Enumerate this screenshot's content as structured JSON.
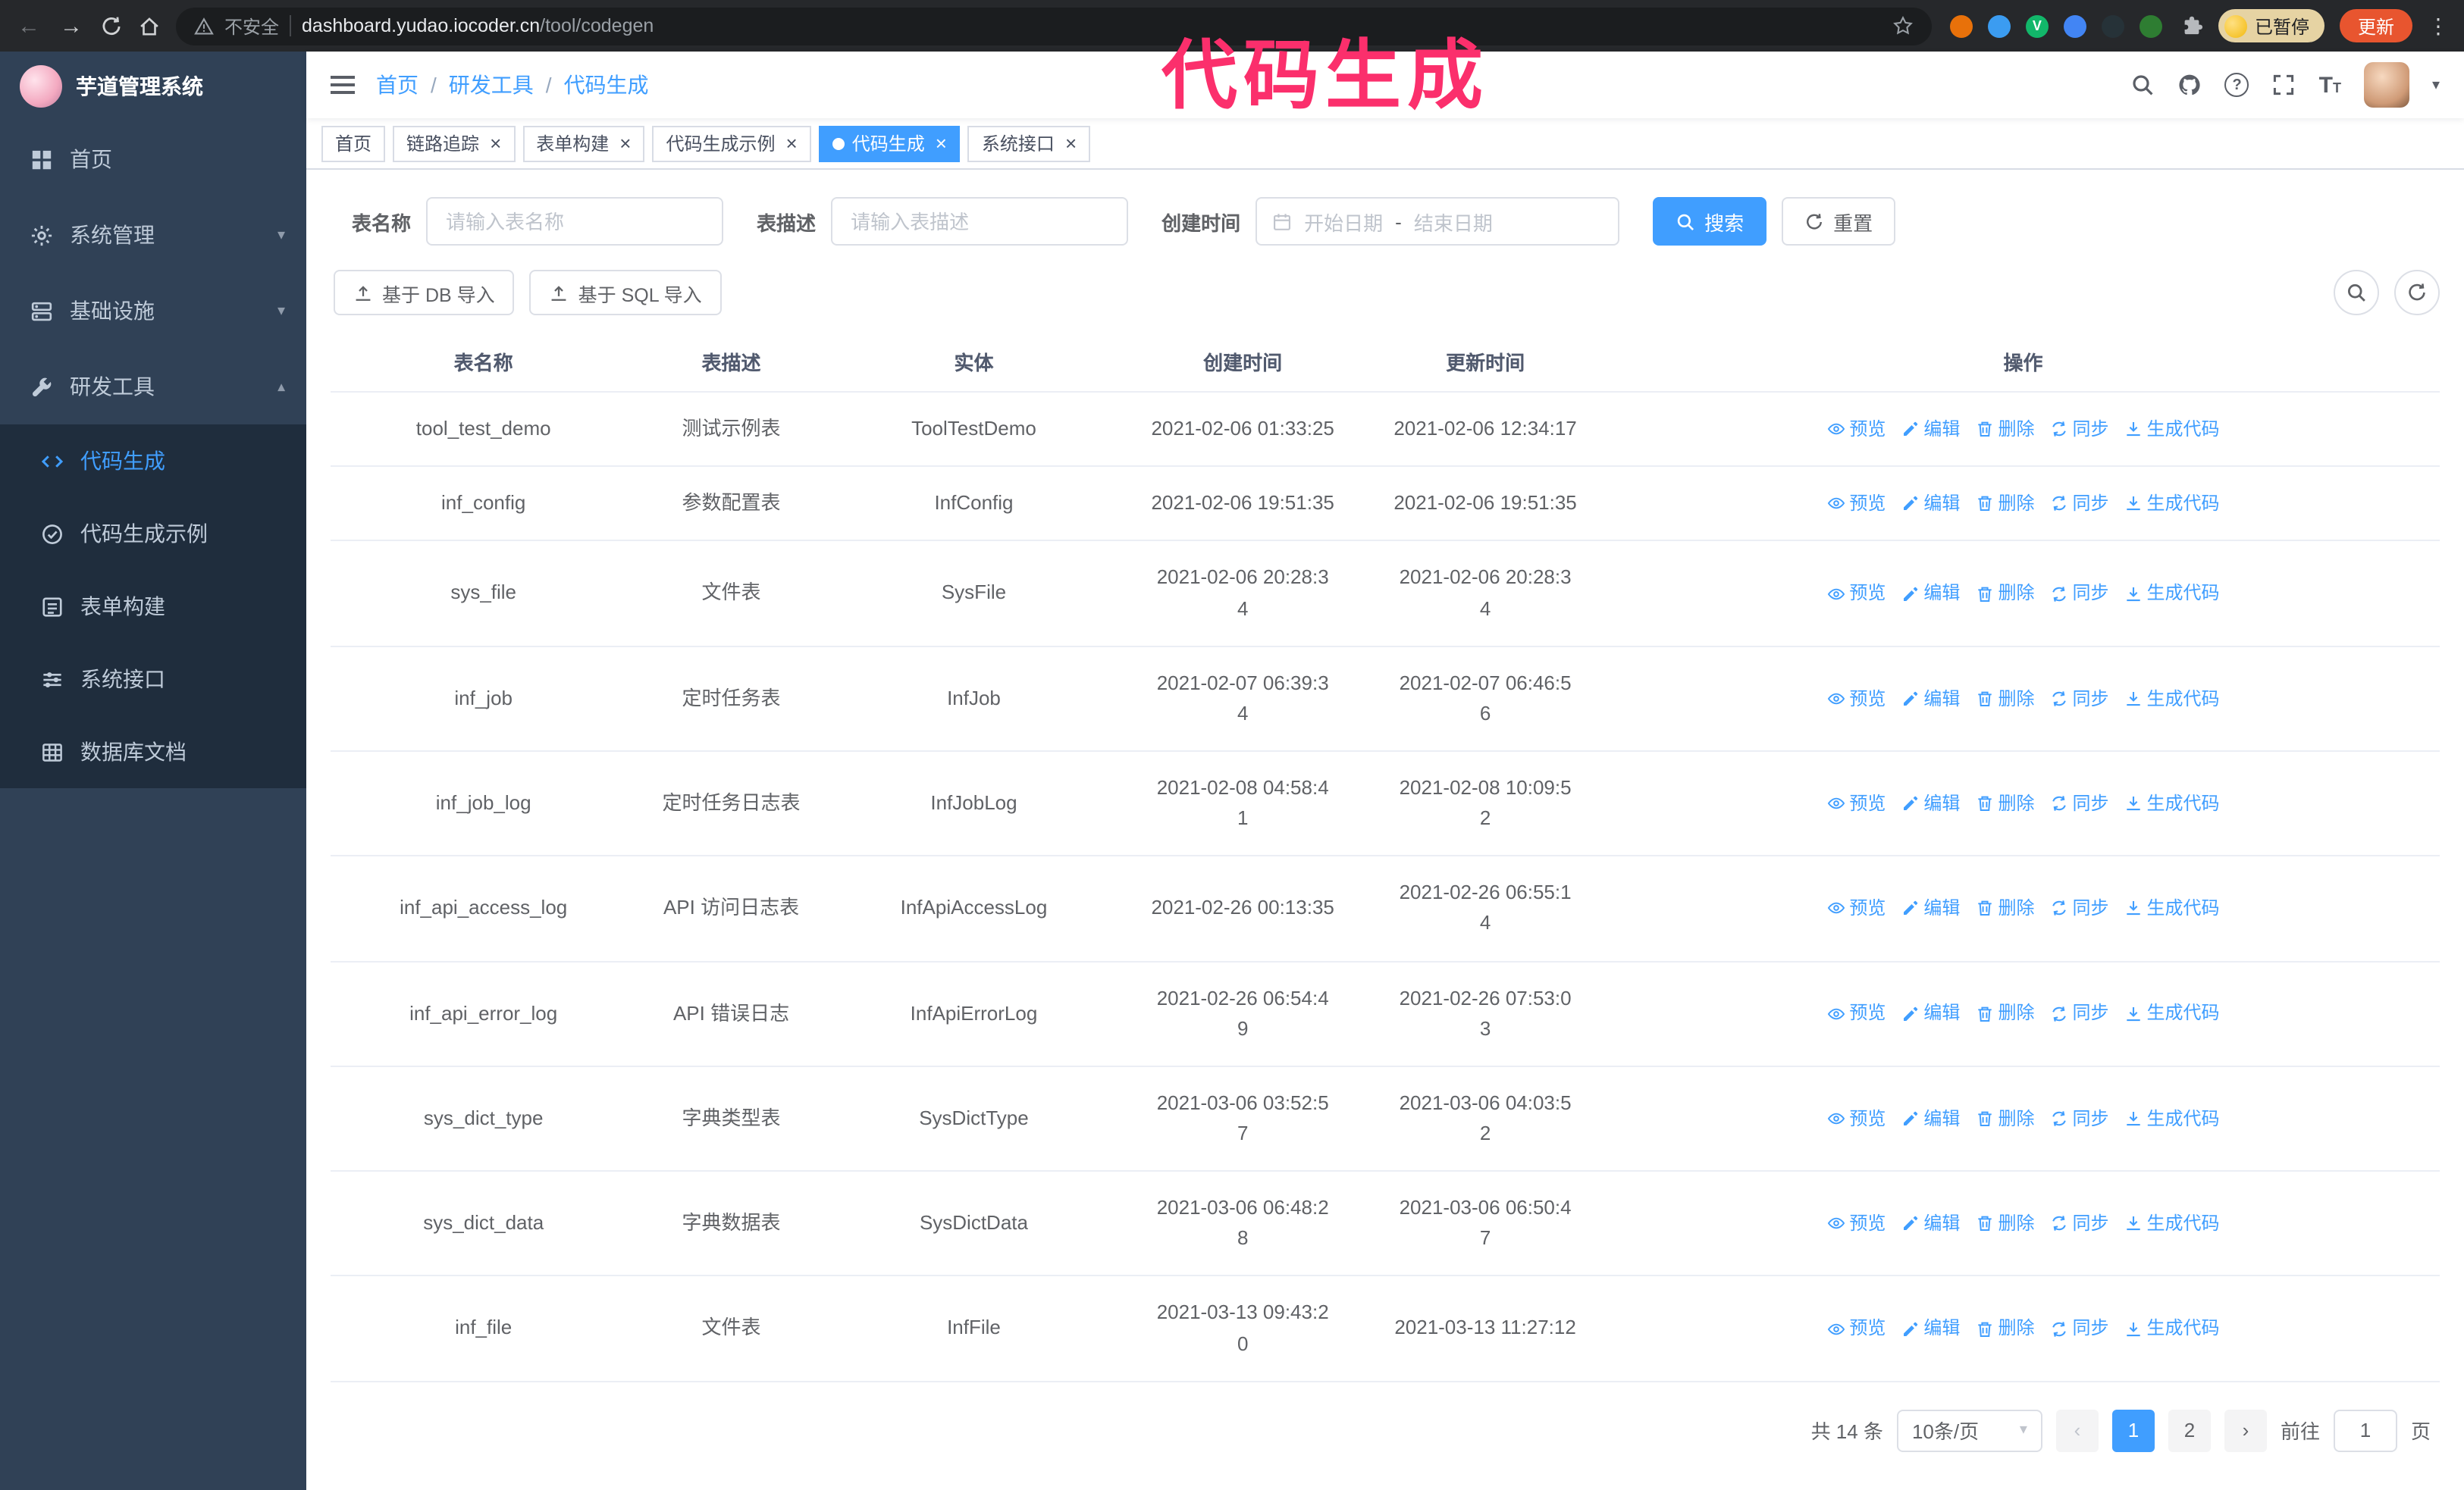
{
  "colors": {
    "accent": "#409eff",
    "sidebar_bg": "#304156",
    "submenu_bg": "#1f2d3d",
    "annotation": "#fb2f6c",
    "update_button": "#e8552f"
  },
  "annotation": {
    "text": "代码生成"
  },
  "browser": {
    "security_label": "不安全",
    "url_host": "dashboard.yudao.iocoder.cn",
    "url_path": "/tool/codegen",
    "profile_label": "已暂停",
    "update_label": "更新",
    "extensions": [
      {
        "name": "extension-icon-1",
        "color": "#e8710a",
        "letter": ""
      },
      {
        "name": "extension-icon-2",
        "color": "#3b9cf1",
        "letter": ""
      },
      {
        "name": "extension-icon-3",
        "color": "#12b76a",
        "letter": "V"
      },
      {
        "name": "extension-icon-4",
        "color": "#4285f4",
        "letter": ""
      },
      {
        "name": "extension-icon-5",
        "color": "#263238",
        "letter": ""
      },
      {
        "name": "extension-icon-6",
        "color": "#2e7d32",
        "letter": ""
      }
    ]
  },
  "sidebar": {
    "logo_title": "芋道管理系统",
    "items": [
      {
        "label": "首页",
        "icon": "dashboard",
        "expandable": false,
        "expanded": false
      },
      {
        "label": "系统管理",
        "icon": "gear",
        "expandable": true,
        "expanded": false
      },
      {
        "label": "基础设施",
        "icon": "server",
        "expandable": true,
        "expanded": false
      },
      {
        "label": "研发工具",
        "icon": "tool",
        "expandable": true,
        "expanded": true
      }
    ],
    "subitems": [
      {
        "label": "代码生成",
        "icon": "code",
        "active": true
      },
      {
        "label": "代码生成示例",
        "icon": "badge",
        "active": false
      },
      {
        "label": "表单构建",
        "icon": "form",
        "active": false
      },
      {
        "label": "系统接口",
        "icon": "sliders",
        "active": false
      },
      {
        "label": "数据库文档",
        "icon": "table",
        "active": false
      }
    ]
  },
  "header": {
    "breadcrumb": [
      "首页",
      "研发工具",
      "代码生成"
    ]
  },
  "tabs": [
    {
      "label": "首页",
      "closable": false,
      "active": false
    },
    {
      "label": "链路追踪",
      "closable": true,
      "active": false
    },
    {
      "label": "表单构建",
      "closable": true,
      "active": false
    },
    {
      "label": "代码生成示例",
      "closable": true,
      "active": false
    },
    {
      "label": "代码生成",
      "closable": true,
      "active": true
    },
    {
      "label": "系统接口",
      "closable": true,
      "active": false
    }
  ],
  "search_form": {
    "table_name_label": "表名称",
    "table_name_placeholder": "请输入表名称",
    "table_desc_label": "表描述",
    "table_desc_placeholder": "请输入表描述",
    "create_time_label": "创建时间",
    "date_start_placeholder": "开始日期",
    "date_separator": "-",
    "date_end_placeholder": "结束日期",
    "search_label": "搜索",
    "reset_label": "重置"
  },
  "toolbar": {
    "import_db_label": "基于 DB 导入",
    "import_sql_label": "基于 SQL 导入"
  },
  "table": {
    "columns": [
      "表名称",
      "表描述",
      "实体",
      "创建时间",
      "更新时间",
      "操作"
    ],
    "row_actions": [
      {
        "label": "预览",
        "icon": "eye"
      },
      {
        "label": "编辑",
        "icon": "edit"
      },
      {
        "label": "删除",
        "icon": "delete"
      },
      {
        "label": "同步",
        "icon": "sync"
      },
      {
        "label": "生成代码",
        "icon": "download"
      }
    ],
    "rows": [
      {
        "name": "tool_test_demo",
        "desc": "测试示例表",
        "entity": "ToolTestDemo",
        "created": "2021-02-06 01:33:25",
        "updated": "2021-02-06 12:34:17"
      },
      {
        "name": "inf_config",
        "desc": "参数配置表",
        "entity": "InfConfig",
        "created": "2021-02-06 19:51:35",
        "updated": "2021-02-06 19:51:35"
      },
      {
        "name": "sys_file",
        "desc": "文件表",
        "entity": "SysFile",
        "created": "2021-02-06 20:28:3\n4",
        "updated": "2021-02-06 20:28:3\n4"
      },
      {
        "name": "inf_job",
        "desc": "定时任务表",
        "entity": "InfJob",
        "created": "2021-02-07 06:39:3\n4",
        "updated": "2021-02-07 06:46:5\n6"
      },
      {
        "name": "inf_job_log",
        "desc": "定时任务日志表",
        "entity": "InfJobLog",
        "created": "2021-02-08 04:58:4\n1",
        "updated": "2021-02-08 10:09:5\n2"
      },
      {
        "name": "inf_api_access_log",
        "desc": "API 访问日志表",
        "entity": "InfApiAccessLog",
        "created": "2021-02-26 00:13:35",
        "updated": "2021-02-26 06:55:1\n4"
      },
      {
        "name": "inf_api_error_log",
        "desc": "API 错误日志",
        "entity": "InfApiErrorLog",
        "created": "2021-02-26 06:54:4\n9",
        "updated": "2021-02-26 07:53:0\n3"
      },
      {
        "name": "sys_dict_type",
        "desc": "字典类型表",
        "entity": "SysDictType",
        "created": "2021-03-06 03:52:5\n7",
        "updated": "2021-03-06 04:03:5\n2"
      },
      {
        "name": "sys_dict_data",
        "desc": "字典数据表",
        "entity": "SysDictData",
        "created": "2021-03-06 06:48:2\n8",
        "updated": "2021-03-06 06:50:4\n7"
      },
      {
        "name": "inf_file",
        "desc": "文件表",
        "entity": "InfFile",
        "created": "2021-03-13 09:43:2\n0",
        "updated": "2021-03-13 11:27:12"
      }
    ]
  },
  "pagination": {
    "total_label": "共 14 条",
    "page_size_label": "10条/页",
    "pages": [
      "1",
      "2"
    ],
    "active_page": "1",
    "prev_icon": "‹",
    "next_icon": "›",
    "goto_label": "前往",
    "goto_value": "1",
    "goto_suffix": "页"
  }
}
